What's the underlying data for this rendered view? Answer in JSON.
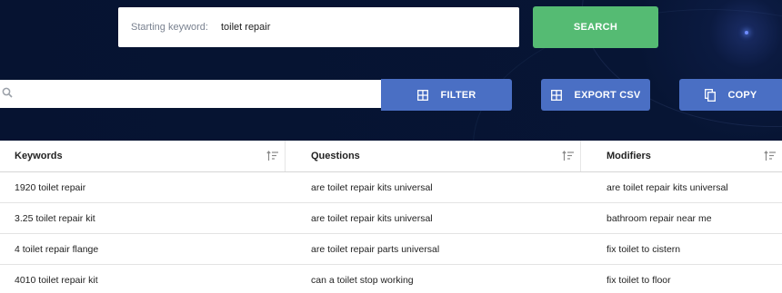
{
  "search": {
    "keyword_label": "Starting keyword:",
    "keyword_value": "toilet repair",
    "search_label": "SEARCH"
  },
  "toolbar": {
    "filter_placeholder": "",
    "filter_label": "FILTER",
    "export_label": "EXPORT CSV",
    "copy_label": "COPY"
  },
  "icons": {
    "search": "search-icon",
    "filter": "grid-icon",
    "export": "grid-icon",
    "copy": "copy-icon",
    "sort": "sort-icon"
  },
  "colors": {
    "hero_bg": "#071534",
    "search_button": "#55bb73",
    "action_button": "#4a6fc4"
  },
  "table": {
    "headers": [
      "Keywords",
      "Questions",
      "Modifiers"
    ],
    "rows": [
      [
        "1920 toilet repair",
        "are toilet repair kits universal",
        "are toilet repair kits universal"
      ],
      [
        "3.25 toilet repair kit",
        "are toilet repair kits universal",
        "bathroom repair near me"
      ],
      [
        "4 toilet repair flange",
        "are toilet repair parts universal",
        "fix toilet to cistern"
      ],
      [
        "4010 toilet repair kit",
        "can a toilet stop working",
        "fix toilet to floor"
      ]
    ]
  }
}
